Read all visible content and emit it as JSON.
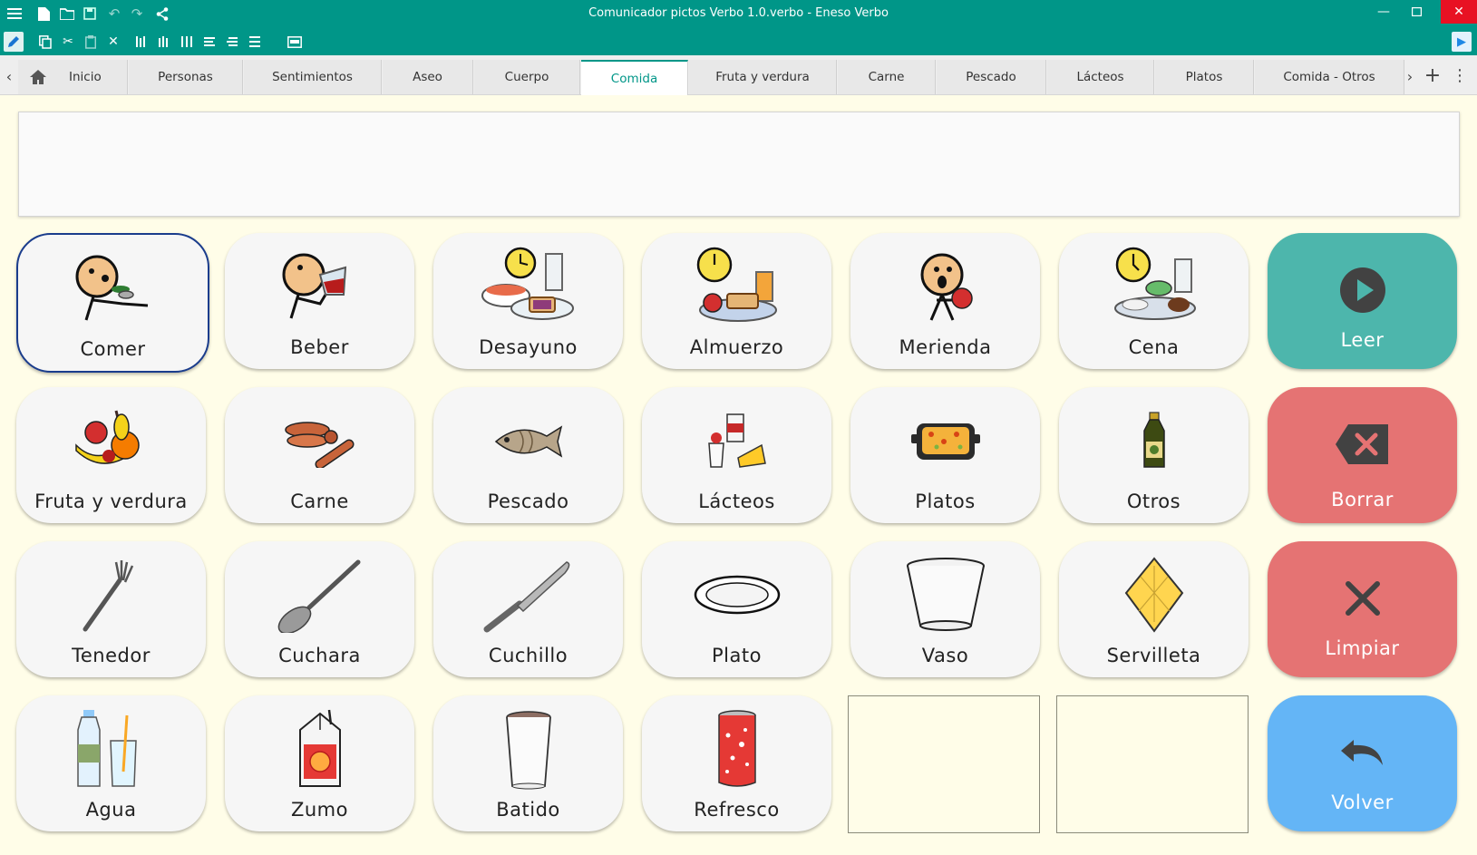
{
  "window": {
    "title": "Comunicador pictos Verbo 1.0.verbo - Eneso Verbo"
  },
  "tabs": {
    "home_label": "Inicio",
    "items": [
      "Personas",
      "Sentimientos",
      "Aseo",
      "Cuerpo",
      "Comida",
      "Fruta y verdura",
      "Carne",
      "Pescado",
      "Lácteos",
      "Platos",
      "Comida - Otros"
    ],
    "active": "Comida"
  },
  "sentence": {
    "text": ""
  },
  "grid": {
    "cells": [
      {
        "label": "Comer",
        "icon": "person-eating-icon",
        "selected": true
      },
      {
        "label": "Beber",
        "icon": "person-drinking-icon"
      },
      {
        "label": "Desayuno",
        "icon": "breakfast-icon"
      },
      {
        "label": "Almuerzo",
        "icon": "lunch-icon"
      },
      {
        "label": "Merienda",
        "icon": "snack-icon"
      },
      {
        "label": "Cena",
        "icon": "dinner-icon"
      },
      {
        "label": "Fruta y verdura",
        "icon": "fruit-icon"
      },
      {
        "label": "Carne",
        "icon": "sausages-icon"
      },
      {
        "label": "Pescado",
        "icon": "fish-icon"
      },
      {
        "label": "Lácteos",
        "icon": "dairy-icon"
      },
      {
        "label": "Platos",
        "icon": "casserole-icon"
      },
      {
        "label": "Otros",
        "icon": "oil-bottle-icon"
      },
      {
        "label": "Tenedor",
        "icon": "fork-icon"
      },
      {
        "label": "Cuchara",
        "icon": "spoon-icon"
      },
      {
        "label": "Cuchillo",
        "icon": "knife-icon"
      },
      {
        "label": "Plato",
        "icon": "plate-icon"
      },
      {
        "label": "Vaso",
        "icon": "glass-icon"
      },
      {
        "label": "Servilleta",
        "icon": "napkin-icon"
      },
      {
        "label": "Agua",
        "icon": "water-icon"
      },
      {
        "label": "Zumo",
        "icon": "juice-box-icon"
      },
      {
        "label": "Batido",
        "icon": "milkshake-icon"
      },
      {
        "label": "Refresco",
        "icon": "soda-can-icon"
      }
    ],
    "actions": [
      {
        "label": "Leer",
        "icon": "play-icon",
        "color": "#4db6ac"
      },
      {
        "label": "Borrar",
        "icon": "backspace-icon",
        "color": "#e57373"
      },
      {
        "label": "Limpiar",
        "icon": "close-icon",
        "color": "#e57373"
      },
      {
        "label": "Volver",
        "icon": "undo-icon",
        "color": "#64b5f6"
      }
    ]
  },
  "colors": {
    "titlebar": "#009688",
    "background": "#fffde8",
    "cell": "#f6f6f6",
    "selected_border": "#1a3c8c"
  }
}
